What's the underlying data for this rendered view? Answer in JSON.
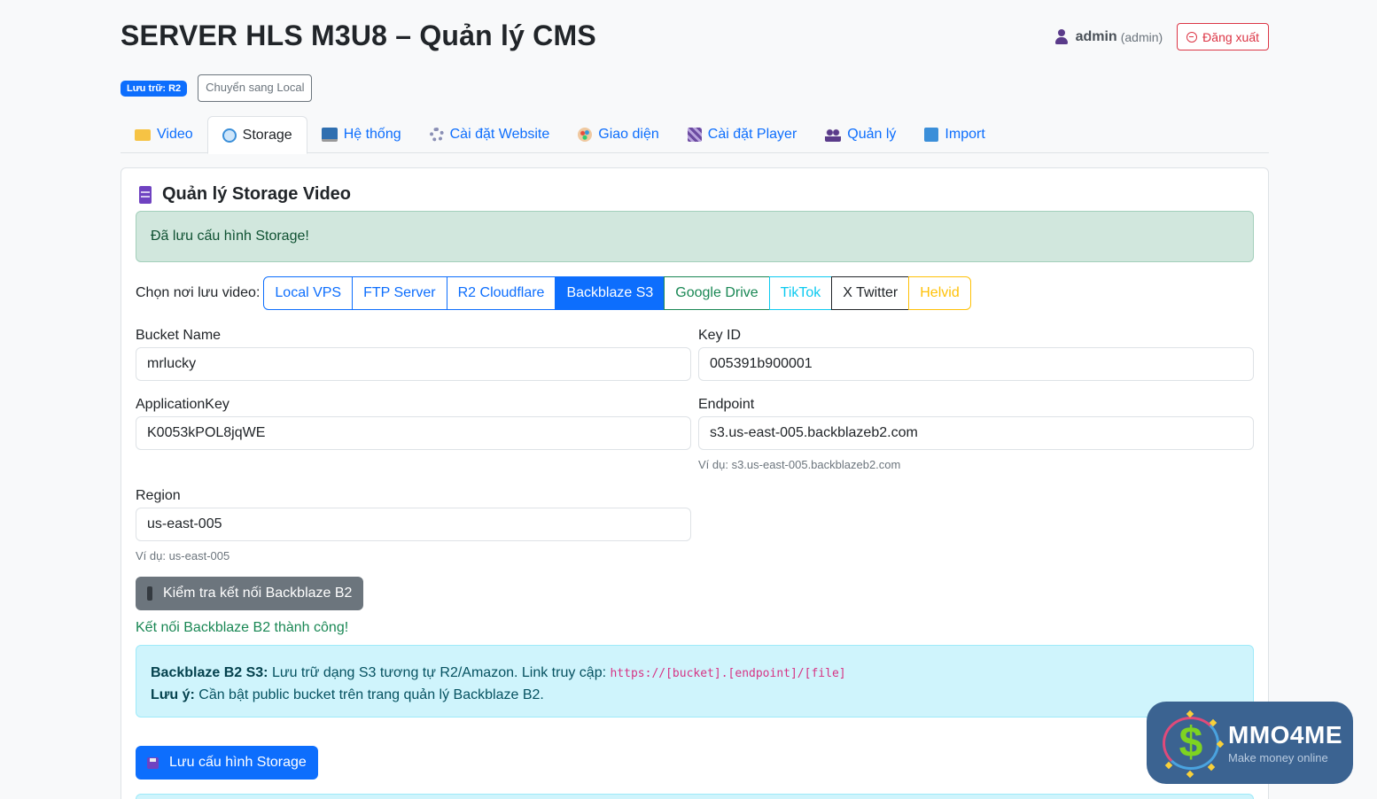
{
  "header": {
    "title": "SERVER HLS M3U8 – Quản lý CMS",
    "user_name": "admin",
    "user_role": "(admin)",
    "logout_label": "Đăng xuất"
  },
  "storage_status": {
    "badge": "Lưu trữ: R2",
    "switch_label": "Chuyển sang Local"
  },
  "tabs": [
    {
      "label": "Video",
      "icon": "folder-icon",
      "active": false
    },
    {
      "label": "Storage",
      "icon": "globe-icon",
      "active": true
    },
    {
      "label": "Hệ thống",
      "icon": "monitor-icon",
      "active": false
    },
    {
      "label": "Cài đặt Website",
      "icon": "gear-icon",
      "active": false
    },
    {
      "label": "Giao diện",
      "icon": "palette-icon",
      "active": false
    },
    {
      "label": "Cài đặt Player",
      "icon": "clapper-icon",
      "active": false
    },
    {
      "label": "Quản lý",
      "icon": "users-icon",
      "active": false
    },
    {
      "label": "Import",
      "icon": "download-icon",
      "active": false
    }
  ],
  "card": {
    "title": "Quản lý Storage Video",
    "alert_success": "Đã lưu cấu hình Storage!",
    "choose_label": "Chọn nơi lưu video:",
    "storage_options": [
      {
        "label": "Local VPS",
        "active": false
      },
      {
        "label": "FTP Server",
        "active": false
      },
      {
        "label": "R2 Cloudflare",
        "active": false
      },
      {
        "label": "Backblaze S3",
        "active": true
      },
      {
        "label": "Google Drive",
        "active": false
      },
      {
        "label": "TikTok",
        "active": false
      },
      {
        "label": "X Twitter",
        "active": false
      },
      {
        "label": "Helvid",
        "active": false
      }
    ],
    "fields": {
      "bucket_name": {
        "label": "Bucket Name",
        "value": "mrlucky"
      },
      "key_id": {
        "label": "Key ID",
        "value": "005391b900001"
      },
      "application_key": {
        "label": "ApplicationKey",
        "value": "K0053kPOL8jqWE"
      },
      "endpoint": {
        "label": "Endpoint",
        "value": "s3.us-east-005.backblazeb2.com",
        "help": "Ví dụ: s3.us-east-005.backblazeb2.com"
      },
      "region": {
        "label": "Region",
        "value": "us-east-005",
        "help": "Ví dụ: us-east-005"
      }
    },
    "test_button": "Kiểm tra kết nối Backblaze B2",
    "test_result": "Kết nối Backblaze B2 thành công!",
    "info": {
      "line1_bold": "Backblaze B2 S3:",
      "line1_text": " Lưu trữ dạng S3 tương tự R2/Amazon. Link truy cập: ",
      "line1_code": "https://[bucket].[endpoint]/[file]",
      "line2_bold": "Lưu ý:",
      "line2_text": " Cần bật public bucket trên trang quản lý Backblaze B2."
    },
    "save_button": "Lưu cấu hình Storage"
  },
  "watermark": {
    "name": "MMO4ME",
    "tagline": "Make money online"
  },
  "colors": {
    "primary": "#0d6efd",
    "danger": "#dc3545",
    "success": "#198754",
    "secondary": "#6c757d",
    "info_bg": "#cff4fc",
    "success_bg": "#d1e7dd"
  }
}
